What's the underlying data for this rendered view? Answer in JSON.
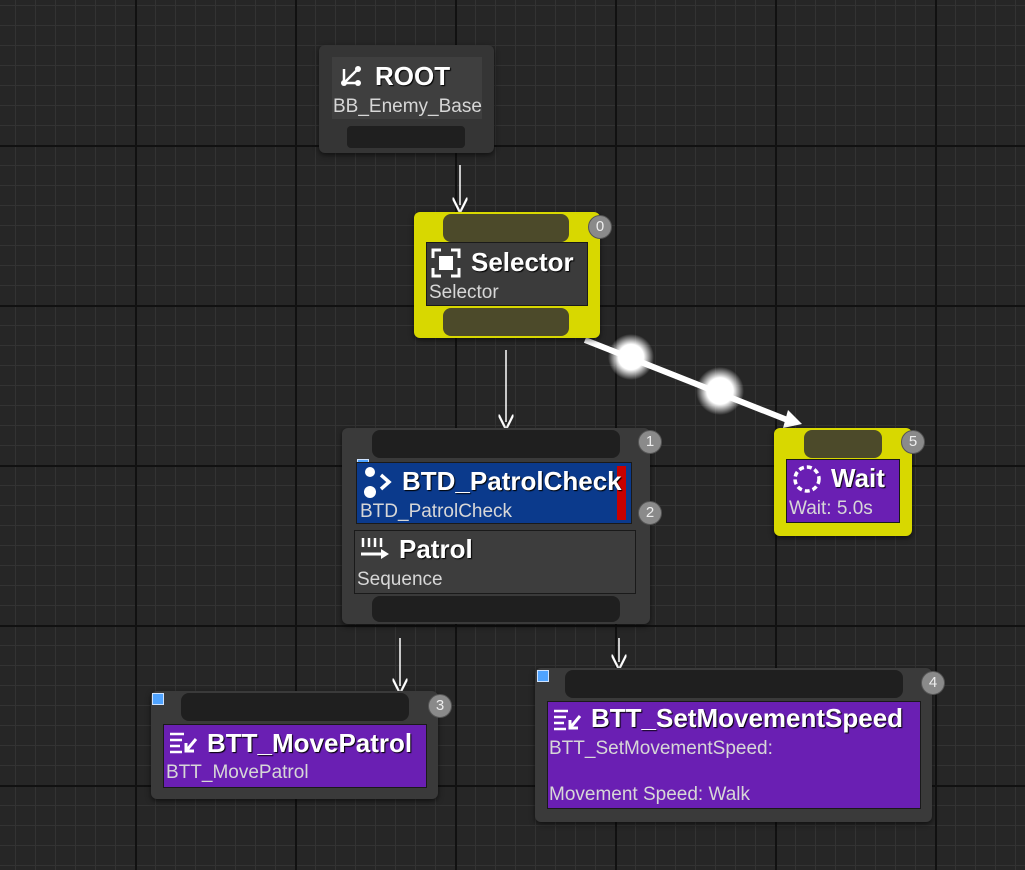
{
  "root": {
    "title": "ROOT",
    "subtitle": "BB_Enemy_Base"
  },
  "selector": {
    "title": "Selector",
    "subtitle": "Selector",
    "index": "0"
  },
  "wait": {
    "title": "Wait",
    "subtitle": "Wait: 5.0s",
    "index": "5"
  },
  "patrol": {
    "index": "1",
    "decorator": {
      "title": "BTD_PatrolCheck",
      "subtitle": "BTD_PatrolCheck",
      "index": "2"
    },
    "composite": {
      "title": "Patrol",
      "subtitle": "Sequence"
    }
  },
  "move_patrol": {
    "title": "BTT_MovePatrol",
    "subtitle": "BTT_MovePatrol",
    "index": "3"
  },
  "set_speed": {
    "title": "BTT_SetMovementSpeed",
    "subtitle": "BTT_SetMovementSpeed:",
    "detail": "Movement Speed: Walk",
    "index": "4"
  },
  "colors": {
    "active_border": "#d8d800",
    "decorator_bg": "#0b3a8c",
    "task_bg": "#6a1fb3",
    "composite_bg": "#3d3d3d",
    "decorator_abort": "#c80000"
  },
  "icons": {
    "root": "root-branch-icon",
    "selector": "selector-icon",
    "wait": "wait-timer-icon",
    "decorator": "decorator-check-icon",
    "sequence": "sequence-icon",
    "task": "task-icon"
  }
}
